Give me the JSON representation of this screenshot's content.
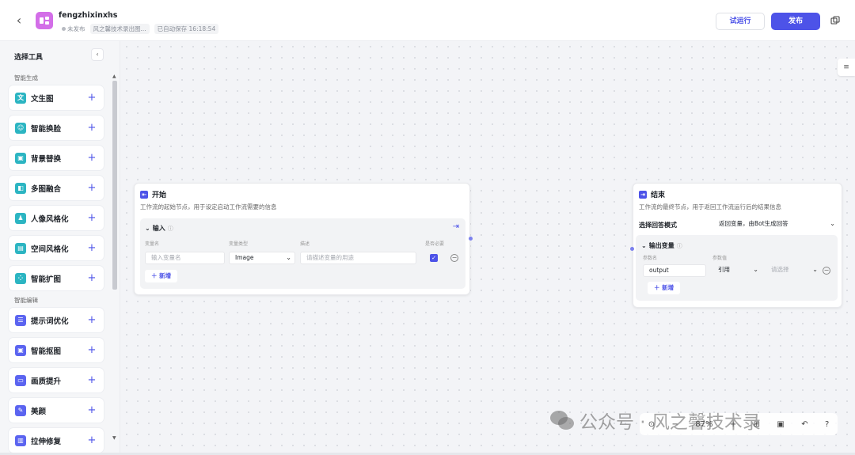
{
  "header": {
    "back_icon": "chevron-left-icon",
    "app_name": "fengzhixinxhs",
    "status": "未发布",
    "description": "风之馨技术录出图...",
    "autosave": "已自动保存 16:18:54",
    "run_label": "试运行",
    "publish_label": "发布",
    "accent": "#4d53e8",
    "logo_color": "#d36ee8"
  },
  "sidebar": {
    "title": "选择工具",
    "section_gen": "智能生成",
    "section_edit": "智能编辑",
    "tools": [
      {
        "label": "文生图",
        "icon": "text-to-image-icon",
        "color": "#2cb5c2",
        "glyph": "文"
      },
      {
        "label": "智能换脸",
        "icon": "face-swap-icon",
        "color": "#2cb5c2",
        "glyph": "☺"
      },
      {
        "label": "背景替换",
        "icon": "background-icon",
        "color": "#2cb5c2",
        "glyph": "▣"
      },
      {
        "label": "多图融合",
        "icon": "merge-icon",
        "color": "#2cb5c2",
        "glyph": "◧"
      },
      {
        "label": "人像风格化",
        "icon": "portrait-icon",
        "color": "#2cb5c2",
        "glyph": "♟"
      },
      {
        "label": "空间风格化",
        "icon": "space-icon",
        "color": "#2cb5c2",
        "glyph": "▤"
      },
      {
        "label": "智能扩图",
        "icon": "expand-icon",
        "color": "#2cb5c2",
        "glyph": "⁘"
      },
      {
        "label": "提示词优化",
        "icon": "prompt-icon",
        "color": "#5b64f0",
        "glyph": "☰"
      },
      {
        "label": "智能抠图",
        "icon": "cutout-icon",
        "color": "#5b64f0",
        "glyph": "▣"
      },
      {
        "label": "画质提升",
        "icon": "quality-icon",
        "color": "#5b64f0",
        "glyph": "▭"
      },
      {
        "label": "美颜",
        "icon": "beauty-icon",
        "color": "#5b64f0",
        "glyph": "✎"
      },
      {
        "label": "拉伸修复",
        "icon": "stretch-icon",
        "color": "#5b64f0",
        "glyph": "▥"
      }
    ]
  },
  "start_node": {
    "title": "开始",
    "desc": "工作流的起始节点，用于设定启动工作流需要的信息",
    "input_title": "输入",
    "col_name": "变量名",
    "col_type": "变量类型",
    "col_desc": "描述",
    "col_required": "是否必要",
    "name_placeholder": "输入变量名",
    "type_value": "Image",
    "desc_placeholder": "请描述变量的用途",
    "add_label": "新增"
  },
  "end_node": {
    "title": "结束",
    "desc": "工作流的最终节点，用于返回工作流运行后的结果信息",
    "mode_label": "选择回答模式",
    "mode_value": "返回变量，由Bot生成回答",
    "output_title": "输出变量",
    "col_param": "参数名",
    "col_value": "参数值",
    "param_value": "output",
    "ref_value": "引用",
    "select_placeholder": "请选择",
    "add_label": "新增"
  },
  "toolbar": {
    "zoom": "87%"
  },
  "watermark": "公众号 · 风之馨技术录"
}
